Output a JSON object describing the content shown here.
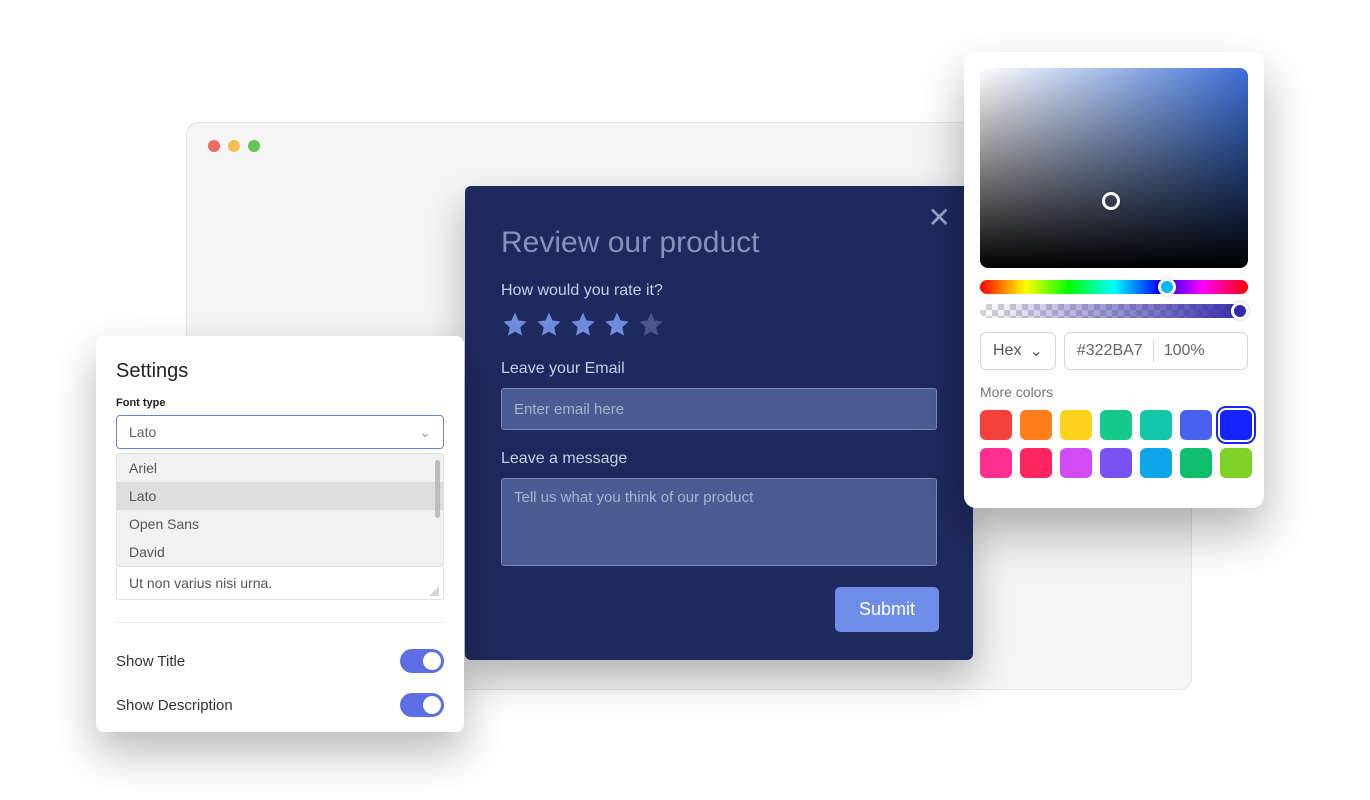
{
  "review": {
    "title": "Review our product",
    "rate_label": "How would you rate it?",
    "rating": 4,
    "max_rating": 5,
    "email_label": "Leave your Email",
    "email_placeholder": "Enter email here",
    "message_label": "Leave a message",
    "message_placeholder": "Tell us what you think of our product",
    "submit_label": "Submit"
  },
  "settings": {
    "title": "Settings",
    "font_label": "Font type",
    "font_selected": "Lato",
    "font_options": [
      "Ariel",
      "Lato",
      "Open Sans",
      "David"
    ],
    "sample_text": "Ut non varius nisi urna.",
    "toggles": [
      {
        "label": "Show Title",
        "on": true
      },
      {
        "label": "Show Description",
        "on": true
      }
    ]
  },
  "picker": {
    "format_label": "Hex",
    "hex_value": "#322BA7",
    "opacity_label": "100%",
    "more_label": "More colors",
    "swatches": [
      "#f5413c",
      "#ff7d1a",
      "#ffd21e",
      "#15c98b",
      "#12c7a8",
      "#4961ef",
      "#1524ff",
      "#ff2f92",
      "#ff2660",
      "#d14af3",
      "#7a52f4",
      "#0ea5e9",
      "#0fbf6e",
      "#7fd125"
    ],
    "selected_swatch": 6
  }
}
